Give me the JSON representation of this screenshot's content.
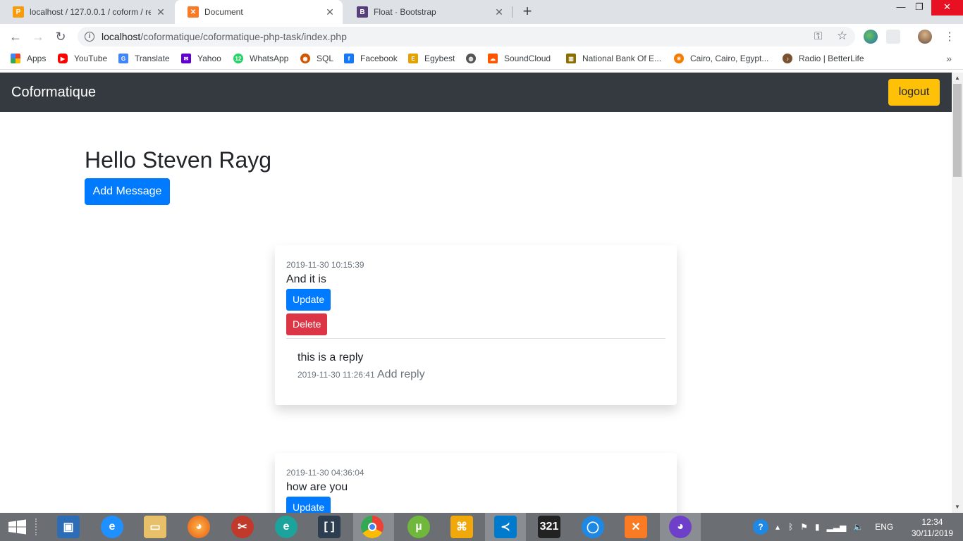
{
  "browser": {
    "tabs": [
      {
        "title": "localhost / 127.0.0.1 / coform / re",
        "favicon": "phpmyadmin-icon",
        "active": false
      },
      {
        "title": "Document",
        "favicon": "xampp-icon",
        "active": true
      },
      {
        "title": "Float · Bootstrap",
        "favicon": "bootstrap-icon",
        "active": false
      }
    ],
    "url_host": "localhost",
    "url_path": "/coformatique/coformatique-php-task/index.php",
    "bookmarks": [
      {
        "label": "Apps",
        "icon": "apps-grid-icon",
        "color": "#e74c3c"
      },
      {
        "label": "YouTube",
        "icon": "youtube-icon",
        "color": "#ff0000"
      },
      {
        "label": "Translate",
        "icon": "translate-icon",
        "color": "#4285f4"
      },
      {
        "label": "Yahoo",
        "icon": "yahoo-icon",
        "color": "#6001d2"
      },
      {
        "label": "WhatsApp",
        "icon": "whatsapp-icon",
        "color": "#25d366"
      },
      {
        "label": "SQL",
        "icon": "sql-icon",
        "color": "#d35400"
      },
      {
        "label": "Facebook",
        "icon": "facebook-icon",
        "color": "#1877f2"
      },
      {
        "label": "Egybest",
        "icon": "egybest-icon",
        "color": "#e5a100"
      },
      {
        "label": "",
        "icon": "globe-icon",
        "color": "#555555"
      },
      {
        "label": "SoundCloud",
        "icon": "soundcloud-icon",
        "color": "#ff5500"
      },
      {
        "label": "National Bank Of E...",
        "icon": "bank-icon",
        "color": "#8b6d00"
      },
      {
        "label": "Cairo, Cairo, Egypt...",
        "icon": "weather-icon",
        "color": "#f57c00"
      },
      {
        "label": "Radio | BetterLife",
        "icon": "radio-icon",
        "color": "#7a5230"
      }
    ]
  },
  "app": {
    "brand": "Coformatique",
    "logout_label": "logout",
    "greeting": "Hello Steven Rayg",
    "add_message_label": "Add Message",
    "messages": [
      {
        "date": "2019-11-30 10:15:39",
        "text": "And it is",
        "update_label": "Update",
        "delete_label": "Delete",
        "reply_text": "this is a reply",
        "reply_date": "2019-11-30 11:26:41",
        "add_reply_label": "Add reply"
      },
      {
        "date": "2019-11-30 04:36:04",
        "text": "how are you",
        "update_label": "Update"
      }
    ]
  },
  "taskbar": {
    "language": "ENG",
    "time": "12:34",
    "date": "30/11/2019"
  },
  "colors": {
    "navbar": "#343a40",
    "primary": "#007bff",
    "danger": "#dc3545",
    "warning": "#ffc107"
  }
}
